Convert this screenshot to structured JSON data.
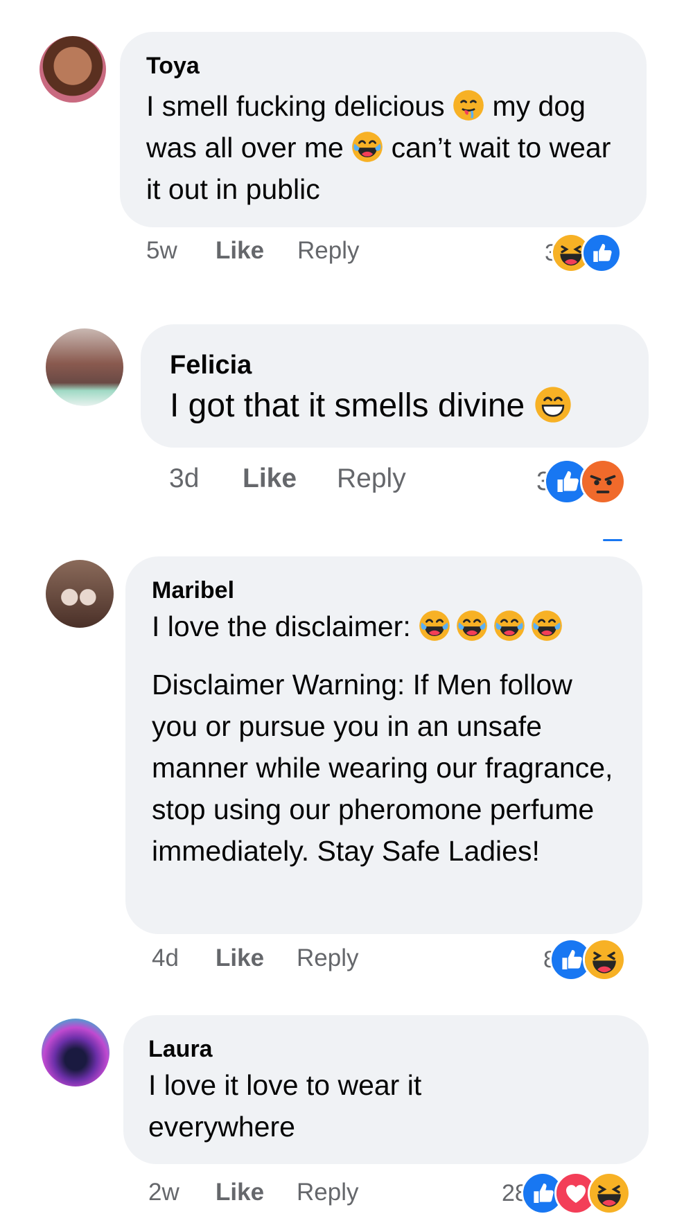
{
  "comments": [
    {
      "author": "Toya",
      "text_parts": [
        "I smell fucking delicious",
        "my dog was all over me",
        "can’t wait to wear it out in public"
      ],
      "time": "5w",
      "like": "Like",
      "reply": "Reply",
      "reaction_count": "3",
      "reactions": [
        "haha-icon",
        "like-icon"
      ]
    },
    {
      "author": "Felicia",
      "text": "I got that it smells divine",
      "time": "3d",
      "like": "Like",
      "reply": "Reply",
      "reaction_count": "3",
      "reactions": [
        "like-icon",
        "angry-icon"
      ]
    },
    {
      "author": "Maribel",
      "text_line1": "I love the disclaimer:",
      "text_body": "Disclaimer Warning: If Men follow you or pursue you in an unsafe manner while wearing our fragrance, stop using our pheromone perfume immediately. Stay Safe Ladies!",
      "time": "4d",
      "like": "Like",
      "reply": "Reply",
      "reaction_count": "8",
      "reactions": [
        "like-icon",
        "haha-icon"
      ]
    },
    {
      "author": "Laura",
      "text": "I love it love to wear it everywhere",
      "time": "2w",
      "like": "Like",
      "reply": "Reply",
      "reaction_count": "28",
      "reactions": [
        "like-icon",
        "love-icon",
        "haha-icon"
      ]
    }
  ],
  "colors": {
    "bubble": "#f0f2f5",
    "meta": "#65676b",
    "like_blue": "#1877f2",
    "love_red": "#f33e58",
    "haha_yellow": "#f7b125"
  }
}
